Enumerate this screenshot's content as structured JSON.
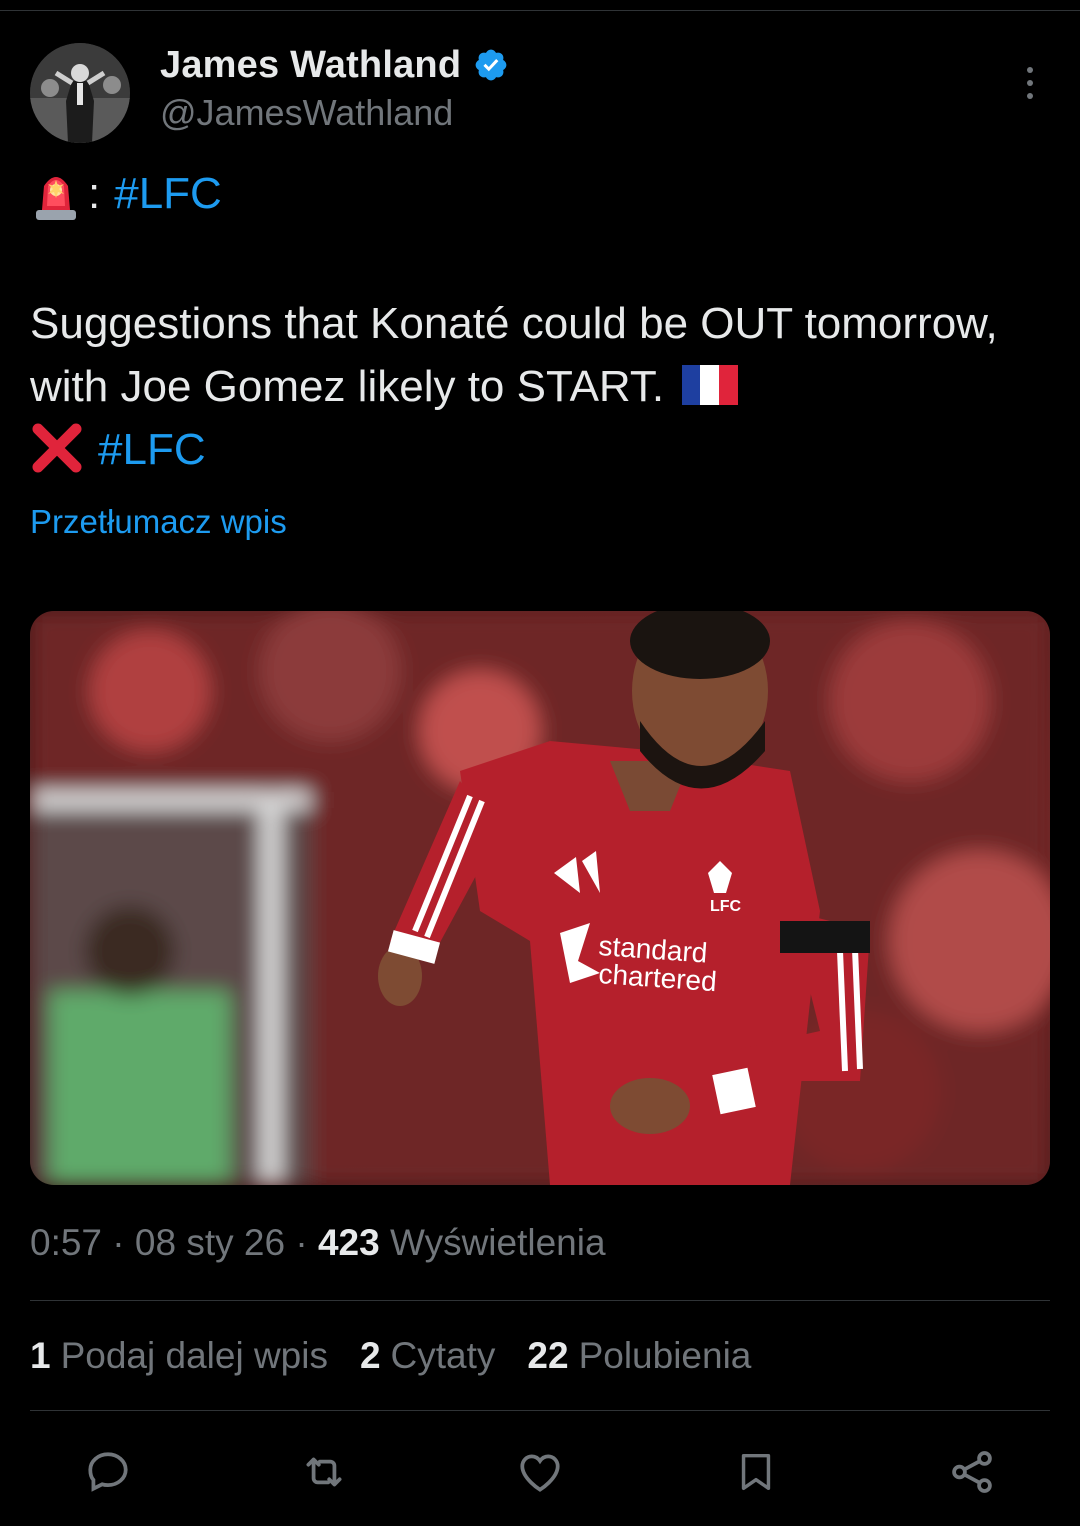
{
  "author": {
    "display_name": "James Wathland",
    "handle": "@JamesWathland",
    "verified": true
  },
  "tweet": {
    "line1_separator": ":",
    "line1_hashtag": "#LFC",
    "body_text": "Suggestions that Konaté could be OUT tomorrow, with Joe Gomez likely to START.",
    "end_hashtag": "#LFC",
    "translate_label": "Przetłumacz wpis"
  },
  "meta": {
    "time": "0:57",
    "date": "08 sty 26",
    "views_count": "423",
    "views_label": "Wyświetlenia",
    "separator": "·"
  },
  "stats": {
    "reposts_count": "1",
    "reposts_label": "Podaj dalej wpis",
    "quotes_count": "2",
    "quotes_label": "Cytaty",
    "likes_count": "22",
    "likes_label": "Polubienia"
  },
  "media": {
    "shirt_sponsor_line1": "standard",
    "shirt_sponsor_line2": "chartered",
    "crest_text": "LFC"
  },
  "colors": {
    "accent": "#1d9bf0",
    "background": "#000000",
    "text_primary": "#e7e9ea",
    "text_secondary": "#71767b"
  },
  "icons": [
    "siren-icon",
    "verified-badge-icon",
    "more-options-icon",
    "france-flag-icon",
    "red-cross-icon",
    "reply-icon",
    "retweet-icon",
    "like-icon",
    "bookmark-icon",
    "share-icon"
  ]
}
